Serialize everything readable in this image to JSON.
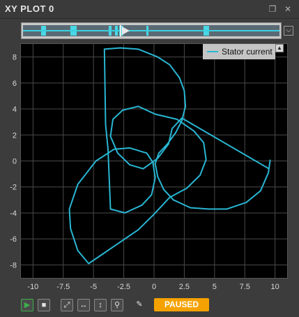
{
  "window": {
    "title": "XY PLOT 0",
    "restore_icon": "restore-icon",
    "close_icon": "close-icon"
  },
  "scrubber": {
    "marks_fraction": [
      [
        0.07,
        0.09
      ],
      [
        0.185,
        0.21
      ],
      [
        0.335,
        0.345
      ],
      [
        0.36,
        0.37
      ],
      [
        0.375,
        0.39
      ],
      [
        0.48,
        0.49
      ],
      [
        0.705,
        0.725
      ]
    ],
    "playhead_fraction": 0.385,
    "dropdown_icon": "chevron-down-icon"
  },
  "legend": {
    "label": "Stator current",
    "color": "#29b6d3",
    "toggle_icon": "chevron-up-icon"
  },
  "toolbar": {
    "play_icon": "play-icon",
    "stop_icon": "stop-icon",
    "fit_icon": "fit-both-icon",
    "fit_x_icon": "fit-horizontal-icon",
    "fit_y_icon": "fit-vertical-icon",
    "zoom_icon": "zoom-icon",
    "clear_icon": "brush-icon",
    "status": "PAUSED",
    "status_color": "#f5a200"
  },
  "chart_data": {
    "type": "scatter",
    "series": [
      {
        "name": "Stator current",
        "color": "#29b6d3",
        "points": [
          [
            9.6,
            0.1
          ],
          [
            9.45,
            -0.9
          ],
          [
            8.8,
            -2.3
          ],
          [
            7.6,
            -3.2
          ],
          [
            6.0,
            -3.7
          ],
          [
            4.5,
            -3.7
          ],
          [
            3.0,
            -3.6
          ],
          [
            1.6,
            -3.0
          ],
          [
            0.8,
            -2.2
          ],
          [
            0.3,
            -1.2
          ],
          [
            0.1,
            -0.2
          ],
          [
            0.4,
            0.6
          ],
          [
            1.1,
            1.3
          ],
          [
            1.8,
            2.2
          ],
          [
            2.3,
            3.1
          ],
          [
            2.6,
            4.2
          ],
          [
            2.5,
            5.4
          ],
          [
            2.1,
            6.4
          ],
          [
            1.3,
            7.4
          ],
          [
            0.3,
            8.0
          ],
          [
            -1.3,
            8.6
          ],
          [
            -2.8,
            8.7
          ],
          [
            -4.1,
            8.6
          ],
          [
            -4.0,
            2.8
          ],
          [
            -3.8,
            0.9
          ],
          [
            -3.6,
            -3.7
          ],
          [
            -2.4,
            -4.0
          ],
          [
            -1.0,
            -3.4
          ],
          [
            -0.2,
            -2.6
          ],
          [
            0.1,
            -1.3
          ],
          [
            -0.1,
            -0.1
          ],
          [
            -0.6,
            0.6
          ],
          [
            -2.0,
            1.0
          ],
          [
            -3.3,
            0.9
          ],
          [
            -4.8,
            0.0
          ],
          [
            -6.3,
            -1.8
          ],
          [
            -7.0,
            -3.7
          ],
          [
            -6.9,
            -5.2
          ],
          [
            -6.3,
            -6.9
          ],
          [
            -5.4,
            -7.9
          ],
          [
            -1.3,
            -5.3
          ],
          [
            0.0,
            -4.1
          ],
          [
            1.3,
            -2.8
          ],
          [
            2.7,
            -2.1
          ],
          [
            3.8,
            -1.1
          ],
          [
            4.3,
            0.1
          ],
          [
            4.1,
            1.4
          ],
          [
            3.3,
            2.3
          ],
          [
            1.9,
            3.2
          ],
          [
            0.1,
            3.6
          ],
          [
            -1.3,
            4.2
          ],
          [
            -2.6,
            3.9
          ],
          [
            -3.4,
            3.2
          ],
          [
            -3.6,
            1.9
          ],
          [
            -3.0,
            0.6
          ],
          [
            -2.0,
            -0.3
          ],
          [
            -0.9,
            -0.6
          ],
          [
            0.3,
            0.2
          ],
          [
            1.2,
            1.3
          ],
          [
            1.5,
            2.5
          ],
          [
            2.3,
            3.3
          ],
          [
            9.5,
            -0.6
          ]
        ]
      }
    ],
    "xlim": [
      -11,
      11
    ],
    "ylim": [
      -9,
      9
    ],
    "xticks": [
      "-10",
      "-7.5",
      "-5",
      "-2.5",
      "0",
      "2.5",
      "5",
      "7.5",
      "10"
    ],
    "xtick_values": [
      -10,
      -7.5,
      -5,
      -2.5,
      0,
      2.5,
      5,
      7.5,
      10
    ],
    "yticks": [
      "8",
      "6",
      "4",
      "2",
      "0",
      "-2",
      "-4",
      "-6",
      "-8"
    ],
    "ytick_values": [
      8,
      6,
      4,
      2,
      0,
      -2,
      -4,
      -6,
      -8
    ],
    "grid": true,
    "legend_position": "top-right",
    "background": "#000000",
    "grid_color": "#4a4a4a"
  }
}
